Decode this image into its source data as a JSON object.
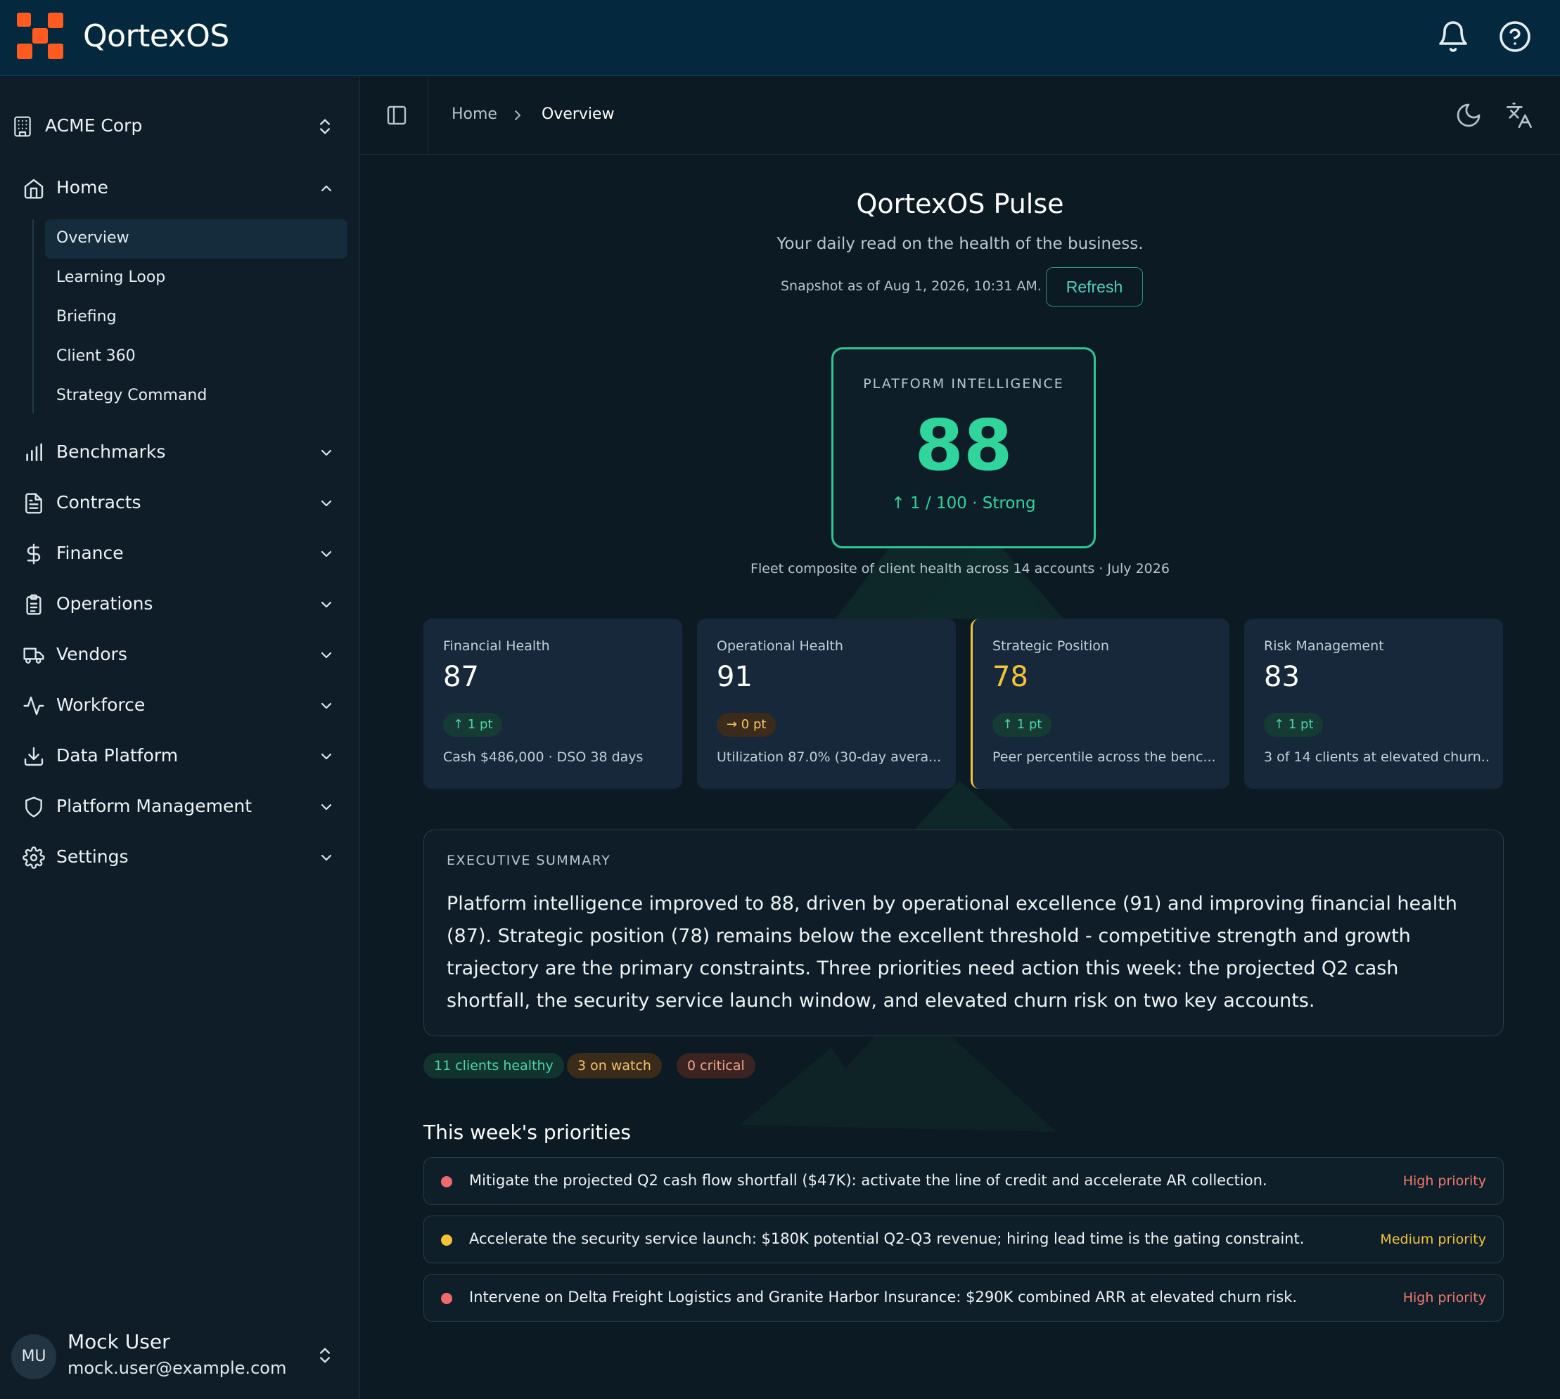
{
  "app": {
    "brand": "QortexOS"
  },
  "sidebar": {
    "org": "ACME Corp",
    "home": {
      "label": "Home",
      "children": [
        "Overview",
        "Learning Loop",
        "Briefing",
        "Client 360",
        "Strategy Command"
      ]
    },
    "items": [
      {
        "label": "Benchmarks",
        "icon": "bar-chart-icon"
      },
      {
        "label": "Contracts",
        "icon": "document-icon"
      },
      {
        "label": "Finance",
        "icon": "dollar-icon"
      },
      {
        "label": "Operations",
        "icon": "clipboard-icon"
      },
      {
        "label": "Vendors",
        "icon": "truck-icon"
      },
      {
        "label": "Workforce",
        "icon": "activity-icon"
      },
      {
        "label": "Data Platform",
        "icon": "download-icon"
      },
      {
        "label": "Platform Management",
        "icon": "shield-icon"
      },
      {
        "label": "Settings",
        "icon": "gear-icon"
      }
    ],
    "user": {
      "initials": "MU",
      "name": "Mock User",
      "email": "mock.user@example.com"
    }
  },
  "breadcrumb": {
    "home": "Home",
    "current": "Overview"
  },
  "pulse": {
    "title": "QortexOS Pulse",
    "subtitle": "Your daily read on the health of the business.",
    "snapshot": "Snapshot as of Aug 1, 2026, 10:31 AM.",
    "refresh_label": "Refresh"
  },
  "platform": {
    "label": "PLATFORM INTELLIGENCE",
    "score": "88",
    "delta": "↑ 1 / 100 · Strong",
    "caption": "Fleet composite of client health across 14 accounts · July 2026"
  },
  "metrics": [
    {
      "name": "Financial Health",
      "value": "87",
      "badge": "↑ 1 pt",
      "foot": "Cash $486,000 · DSO 38 days"
    },
    {
      "name": "Operational Health",
      "value": "91",
      "badge": "→ 0 pt",
      "foot": "Utilization 87.0% (30-day avera..."
    },
    {
      "name": "Strategic Position",
      "value": "78",
      "badge": "↑ 1 pt",
      "foot": "Peer percentile across the benc..."
    },
    {
      "name": "Risk Management",
      "value": "83",
      "badge": "↑ 1 pt",
      "foot": "3 of 14 clients at elevated churn..."
    }
  ],
  "executive": {
    "label": "EXECUTIVE SUMMARY",
    "text": "Platform intelligence improved to 88, driven by operational excellence (91) and improving financial health (87). Strategic position (78) remains below the excellent threshold - competitive strength and growth trajectory are the primary constraints. Three priorities need action this week: the projected Q2 cash shortfall, the security service launch window, and elevated churn risk on two key accounts."
  },
  "pills": {
    "healthy": "11 clients healthy",
    "watch": "3 on watch",
    "critical": "0 critical"
  },
  "priorities": {
    "title": "This week's priorities",
    "items": [
      {
        "text": "Mitigate the projected Q2 cash flow shortfall ($47K): activate the line of credit and accelerate AR collection.",
        "level": "High priority"
      },
      {
        "text": "Accelerate the security service launch: $180K potential Q2-Q3 revenue; hiring lead time is the gating constraint.",
        "level": "Medium priority"
      },
      {
        "text": "Intervene on Delta Freight Logistics and Granite Harbor Insurance: $290K combined ARR at elevated churn risk.",
        "level": "High priority"
      }
    ]
  },
  "colors": {
    "accent": "#2fd59b",
    "brand": "#ff5a1f",
    "warning": "#f3c33a",
    "danger": "#ef6a6a"
  }
}
